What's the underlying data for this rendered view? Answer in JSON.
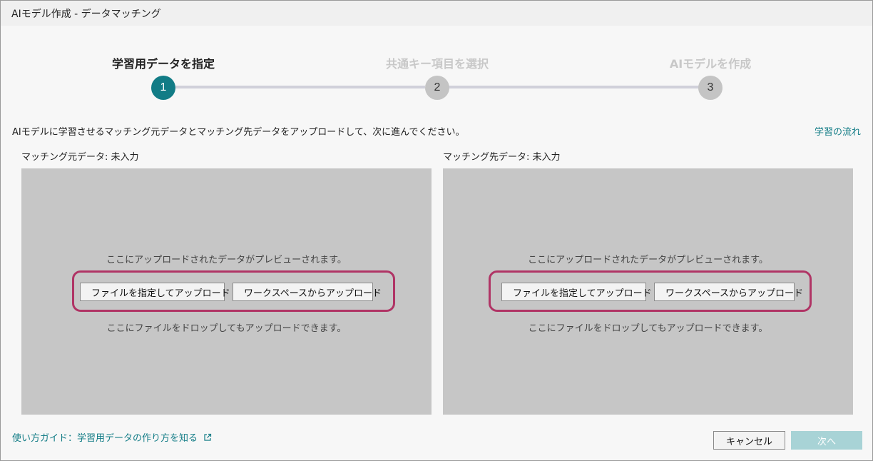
{
  "window": {
    "title": "AIモデル作成 - データマッチング"
  },
  "stepper": {
    "steps": [
      {
        "number": "1",
        "label": "学習用データを指定",
        "state": "active"
      },
      {
        "number": "2",
        "label": "共通キー項目を選択",
        "state": "inactive"
      },
      {
        "number": "3",
        "label": "AIモデルを作成",
        "state": "inactive"
      }
    ]
  },
  "instruction": "AIモデルに学習させるマッチング元データとマッチング先データをアップロードして、次に進んでください。",
  "flow_link": "学習の流れ",
  "panels": [
    {
      "title": "マッチング元データ: 未入力",
      "preview_text": "ここにアップロードされたデータがプレビューされます。",
      "file_button": "ファイルを指定してアップロード",
      "workspace_button": "ワークスペースからアップロード",
      "drop_text": "ここにファイルをドロップしてもアップロードできます。"
    },
    {
      "title": "マッチング先データ: 未入力",
      "preview_text": "ここにアップロードされたデータがプレビューされます。",
      "file_button": "ファイルを指定してアップロード",
      "workspace_button": "ワークスペースからアップロード",
      "drop_text": "ここにファイルをドロップしてもアップロードできます。"
    }
  ],
  "footer": {
    "guide_link": "使い方ガイド：学習用データの作り方を知る",
    "cancel_label": "キャンセル",
    "next_label": "次へ"
  },
  "colors": {
    "accent": "#127c86",
    "highlight": "#b03465",
    "panel": "#c6c6c6",
    "disabled_button": "#a8d3d6"
  },
  "icons": [
    "folder-upload-icon",
    "folder-workspace-icon",
    "external-link-icon"
  ]
}
